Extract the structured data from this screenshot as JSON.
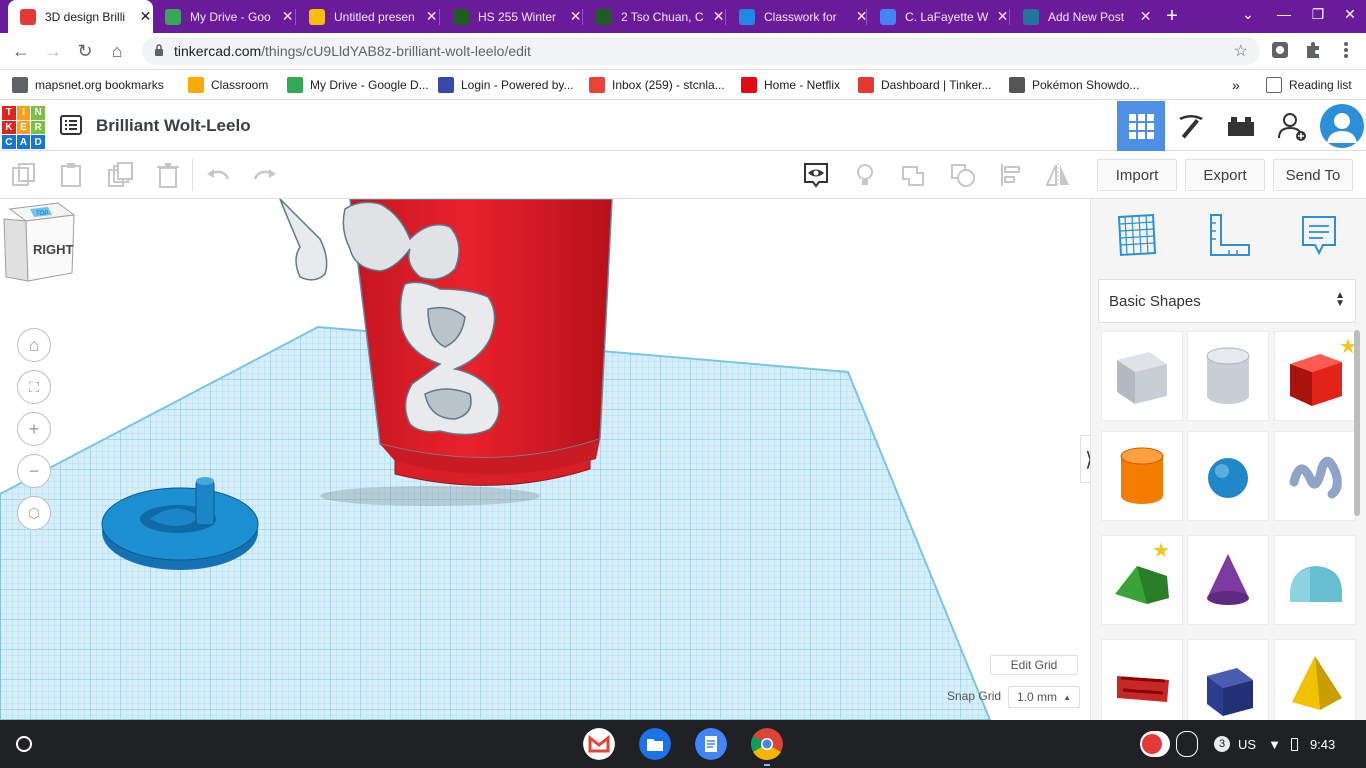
{
  "browser": {
    "tabs": [
      {
        "title": "3D design Brilli",
        "active": true,
        "favicon": "tinkercad-favicon",
        "color": "#e53935"
      },
      {
        "title": "My Drive - Goo",
        "active": false,
        "favicon": "google-drive-favicon",
        "color": "#34a853"
      },
      {
        "title": "Untitled presen",
        "active": false,
        "favicon": "google-slides-favicon",
        "color": "#fbbc04"
      },
      {
        "title": "HS 255 Winter",
        "active": false,
        "favicon": "n-favicon",
        "color": "#1b5e20"
      },
      {
        "title": "2 Tso Chuan, C",
        "active": false,
        "favicon": "n-favicon",
        "color": "#1b5e20"
      },
      {
        "title": "Classwork for",
        "active": false,
        "favicon": "classroom-favicon",
        "color": "#1e88e5"
      },
      {
        "title": "C. LaFayette W",
        "active": false,
        "favicon": "google-docs-favicon",
        "color": "#4285f4"
      },
      {
        "title": "Add New Post",
        "active": false,
        "favicon": "wordpress-favicon",
        "color": "#21759b"
      }
    ],
    "url_host": "tinkercad.com",
    "url_path": "/things/cU9LldYAB8z-brilliant-wolt-leelo/edit",
    "bookmarks": [
      {
        "label": "mapsnet.org bookmarks",
        "icon": "folder-icon",
        "color": "#5f6368"
      },
      {
        "label": "Classroom",
        "icon": "classroom-icon",
        "color": "#f9ab00"
      },
      {
        "label": "My Drive - Google D...",
        "icon": "google-drive-icon",
        "color": "#34a853"
      },
      {
        "label": "Login - Powered by...",
        "icon": "login-icon",
        "color": "#3949ab"
      },
      {
        "label": "Inbox (259) - stcnla...",
        "icon": "gmail-icon",
        "color": "#ea4335"
      },
      {
        "label": "Home - Netflix",
        "icon": "netflix-icon",
        "color": "#e50914"
      },
      {
        "label": "Dashboard | Tinker...",
        "icon": "tinkercad-icon",
        "color": "#e53935"
      },
      {
        "label": "Pokémon Showdo...",
        "icon": "pokemon-icon",
        "color": "#555555"
      }
    ],
    "reading_list": "Reading list",
    "more_bookmarks": "»"
  },
  "tinkercad": {
    "logo_letters": [
      "T",
      "I",
      "N",
      "K",
      "E",
      "R",
      "C",
      "A",
      "D"
    ],
    "logo_colors": [
      "#e2231a",
      "#f9a11b",
      "#7ac143",
      "#e2231a",
      "#f9a11b",
      "#7ac143",
      "#1477d4",
      "#1477d4",
      "#1477d4"
    ],
    "design_title": "Brilliant Wolt-Leelo",
    "header_buttons": [
      "3d-design-grid-icon",
      "pickaxe-icon",
      "brick-icon",
      "add-user-icon",
      "profile-avatar"
    ],
    "toolbar": {
      "import_label": "Import",
      "export_label": "Export",
      "send_to_label": "Send To"
    },
    "viewcube_label": "RIGHT",
    "viewcube_top": "TOP",
    "edit_grid_label": "Edit Grid",
    "snap_grid_label": "Snap Grid",
    "snap_grid_value": "1.0 mm",
    "shapes_panel": {
      "category": "Basic Shapes",
      "shapes": [
        {
          "name": "box-hole",
          "color": "#bcc3cc"
        },
        {
          "name": "cylinder-hole",
          "color": "#bcc3cc"
        },
        {
          "name": "box",
          "color": "#e2231a"
        },
        {
          "name": "cylinder",
          "color": "#f57c00"
        },
        {
          "name": "sphere",
          "color": "#1e88c8"
        },
        {
          "name": "scribble",
          "color": "#90a4c8"
        },
        {
          "name": "roof",
          "color": "#3aa335"
        },
        {
          "name": "cone",
          "color": "#7b3aa0"
        },
        {
          "name": "round-roof",
          "color": "#66bfd0"
        },
        {
          "name": "text",
          "color": "#c62828"
        },
        {
          "name": "prism",
          "color": "#2b3d8c"
        },
        {
          "name": "pyramid",
          "color": "#f2c200"
        }
      ]
    }
  },
  "shelf": {
    "apps": [
      "gmail-icon",
      "files-icon",
      "docs-icon",
      "chrome-icon"
    ],
    "notification_count": "3",
    "keyboard": "US",
    "time": "9:43"
  }
}
